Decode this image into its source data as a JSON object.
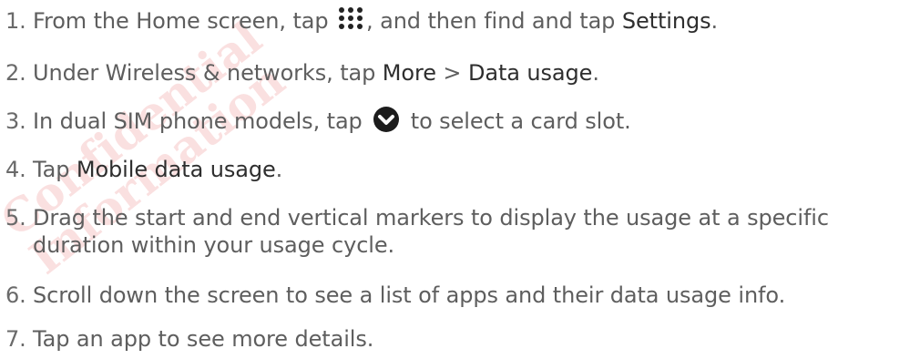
{
  "watermark": "Confidential\nInformation",
  "steps": [
    {
      "num": "1.",
      "before": "From the Home screen, tap ",
      "icon": "apps-grid-icon",
      "after1": ", and then find and tap ",
      "ui1": "Settings",
      "after2": "."
    },
    {
      "num": "2.",
      "before": "Under Wireless & networks, tap ",
      "ui1": "More",
      "mid": " > ",
      "ui2": "Data usage",
      "after": "."
    },
    {
      "num": "3.",
      "before": "In dual SIM phone models, tap ",
      "icon": "chevron-down-circle-icon",
      "after": " to select a card slot."
    },
    {
      "num": "4.",
      "before": "Tap ",
      "ui1": "Mobile data usage",
      "after": "."
    },
    {
      "num": "5.",
      "line1": "Drag the start and end vertical markers to display the usage at a specific",
      "line2": "duration within your usage cycle."
    },
    {
      "num": "6.",
      "text": "Scroll down the screen to see a list of apps and their data usage info."
    },
    {
      "num": "7.",
      "text": "Tap an app to see more details."
    }
  ],
  "colors": {
    "body_text": "#5e5e5e",
    "ui_term": "#2e2e2e",
    "watermark": "#e23c3c"
  }
}
